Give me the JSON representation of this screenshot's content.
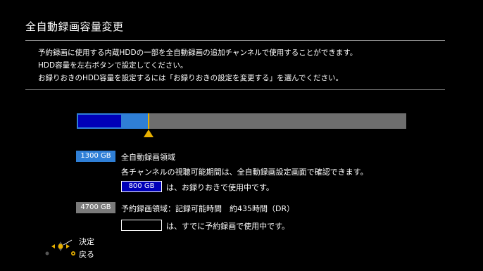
{
  "header": {
    "title": "全自動録画容量変更"
  },
  "description": {
    "line1": "予約録画に使用する内蔵HDDの一部を全自動録画の追加チャンネルで使用することができます。",
    "line2": "HDD容量を左右ボタンで設定してください。",
    "line3": "お録りおきのHDD容量を設定するには「お録りおきの設定を変更する」を選んでください。"
  },
  "capacity_bar": {
    "auto_fraction": 0.217,
    "recorded_fraction": 0.134,
    "colors": {
      "auto": "#2f7fd6",
      "recorded": "#0000b8",
      "reserved": "#6e6e6e",
      "marker": "#e8b000"
    }
  },
  "auto_area": {
    "badge": "1300 GB",
    "label": "全自動録画領域",
    "note": "各チャンネルの視聴可能期間は、全自動録画設定画面で確認できます。",
    "recorded_badge": "800 GB",
    "recorded_text": "は、お録りおきで使用中です。"
  },
  "reserved_area": {
    "badge": "4700 GB",
    "label": "予約録画領域：記録可能時間　約435時間（DR）",
    "in_use_text": "は、すでに予約録画で使用中です。"
  },
  "nav_hints": {
    "icon": "dpad-icon",
    "confirm": "決定",
    "back": "戻る"
  }
}
